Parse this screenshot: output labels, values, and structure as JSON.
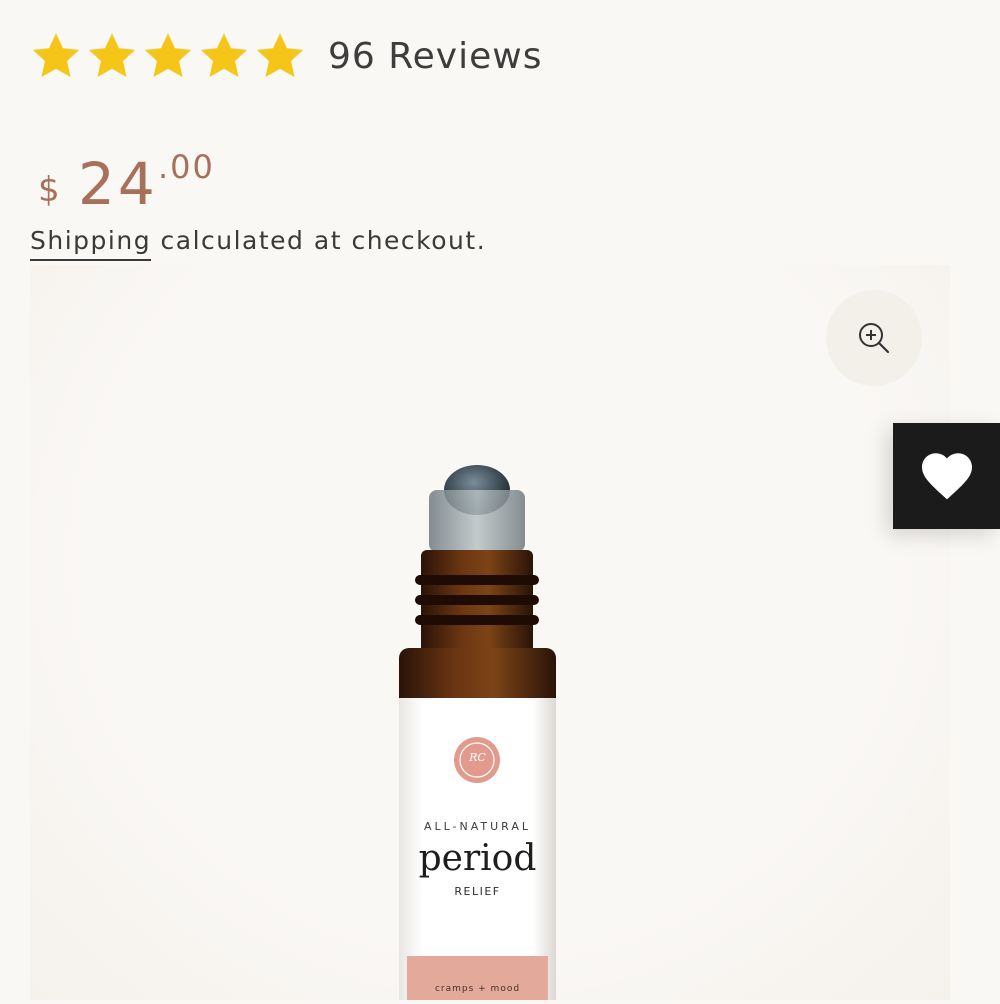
{
  "rating": {
    "stars": 5,
    "star_color": "#f5c518",
    "reviews_label": "96 Reviews"
  },
  "price": {
    "currency": "$",
    "whole": "24",
    "cents": ".00",
    "color": "#a8705a"
  },
  "shipping": {
    "link_label": "Shipping",
    "rest": " calculated at checkout."
  },
  "media": {
    "zoom_icon": "zoom-in-icon",
    "wishlist_icon": "heart-icon"
  },
  "product_label": {
    "monogram": "RC",
    "all_natural": "ALL-NATURAL",
    "name": "period",
    "subname": "RELIEF",
    "tag": "cramps + mood"
  }
}
